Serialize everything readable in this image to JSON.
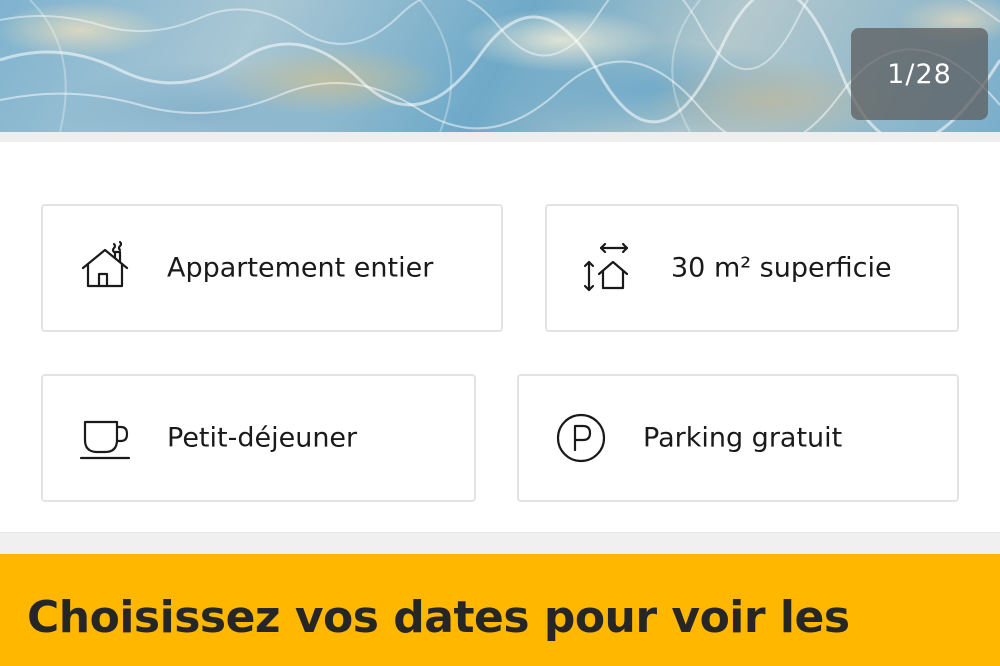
{
  "gallery": {
    "counter": "1/28"
  },
  "features": [
    {
      "icon": "house-icon",
      "label": "Appartement entier"
    },
    {
      "icon": "area-icon",
      "label": "30 m² superficie"
    },
    {
      "icon": "coffee-cup-icon",
      "label": "Petit-déjeuner"
    },
    {
      "icon": "parking-icon",
      "label": "Parking gratuit"
    }
  ],
  "cta": {
    "title": "Choisissez vos dates pour voir les"
  },
  "colors": {
    "cta_background": "#ffb700",
    "card_border": "#e3e3e3"
  }
}
